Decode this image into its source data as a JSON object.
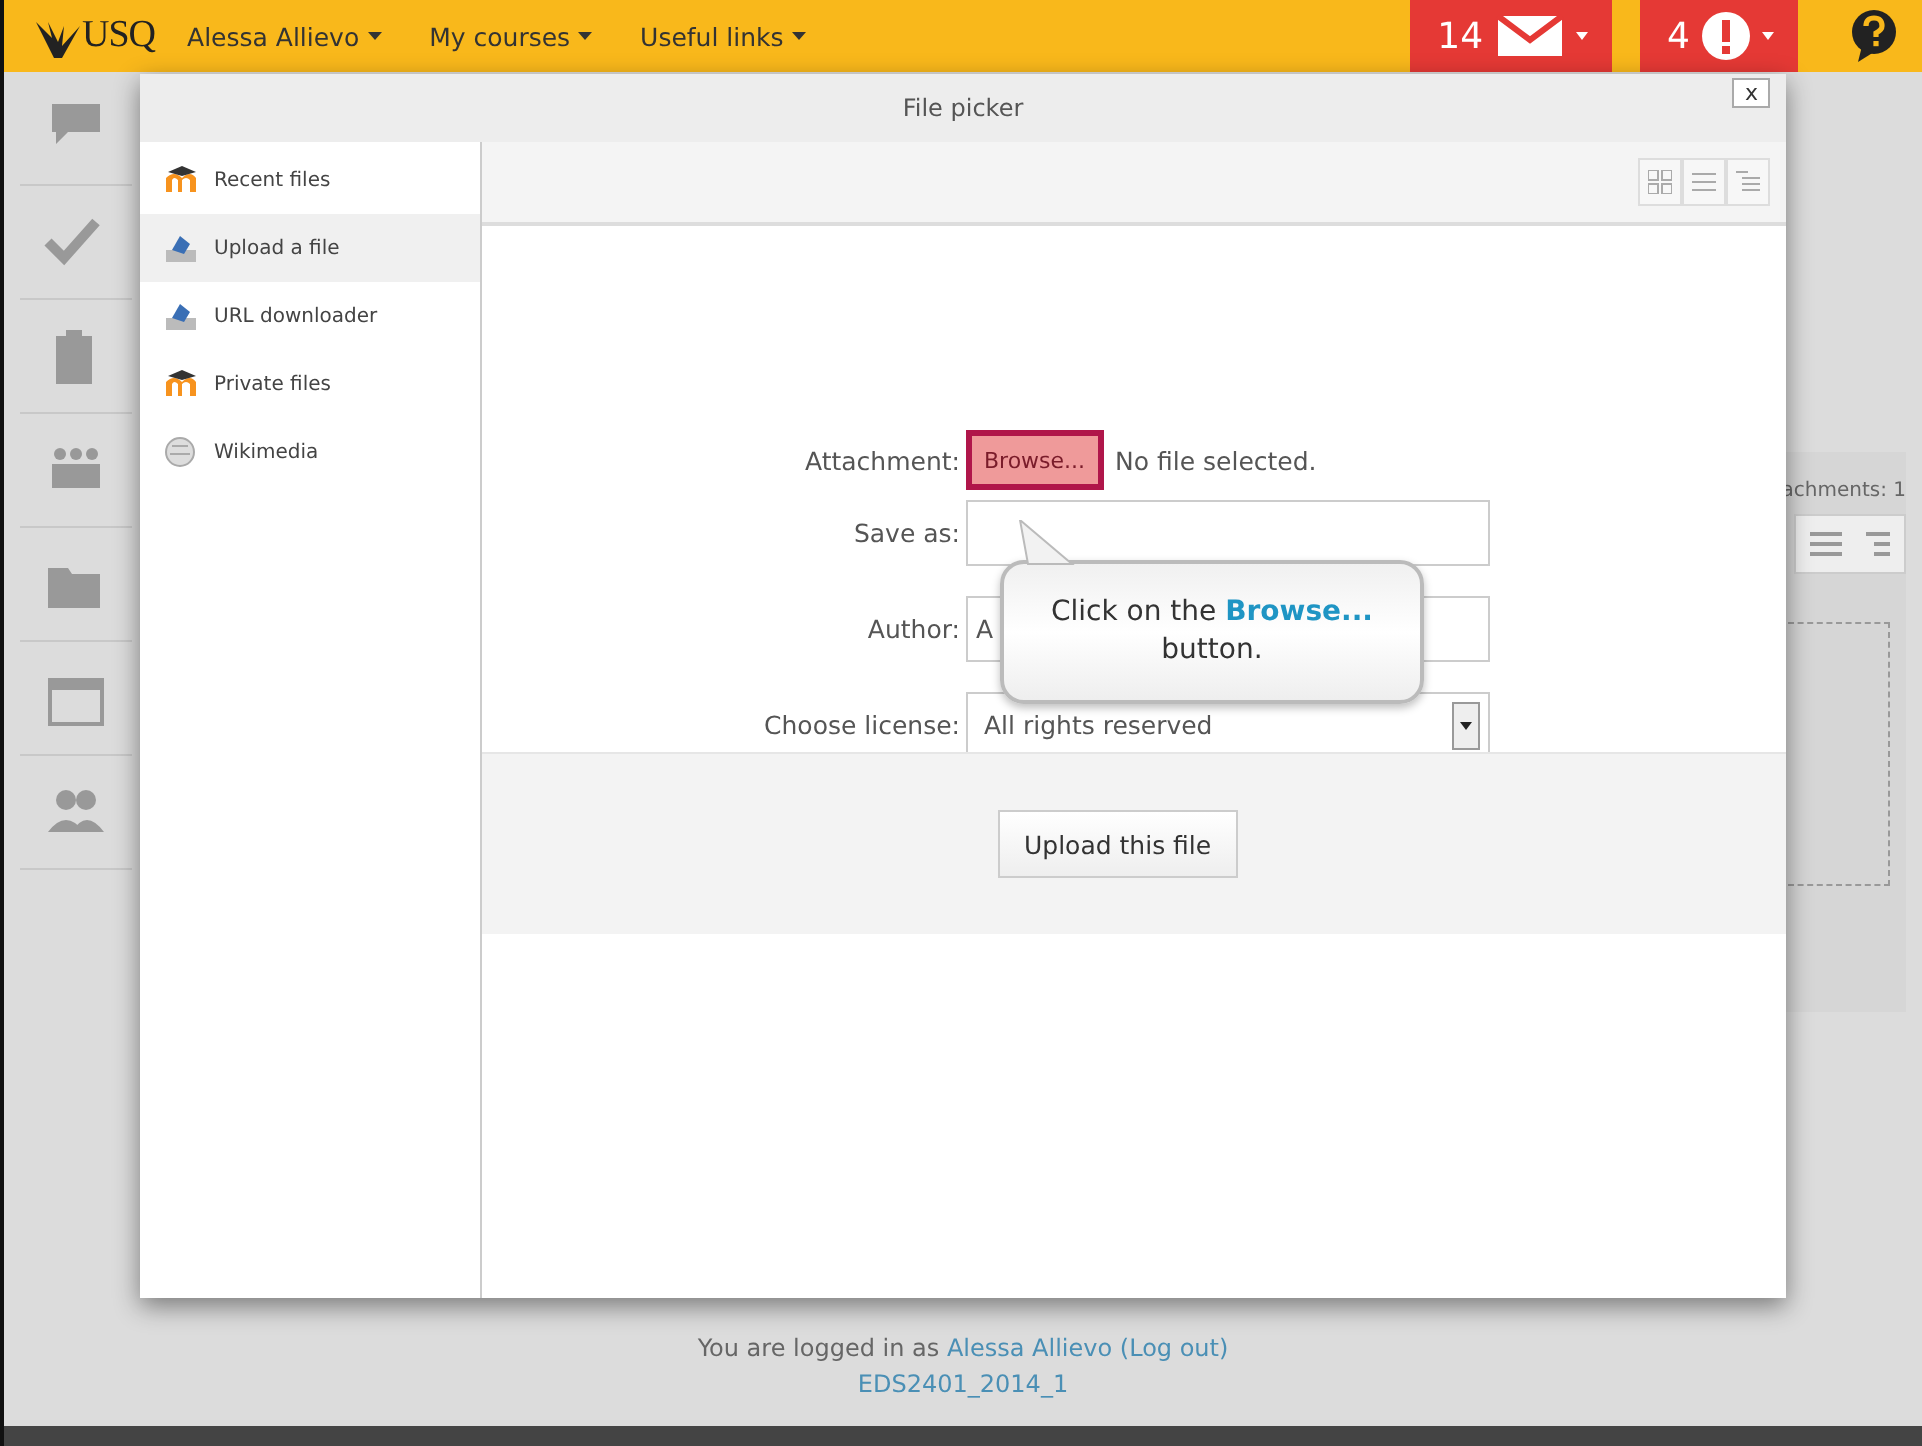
{
  "topbar": {
    "logo": "USQ",
    "menus": [
      {
        "label": "Alessa Allievo"
      },
      {
        "label": "My courses"
      },
      {
        "label": "Useful links"
      }
    ],
    "messages": {
      "count": "14"
    },
    "notifications": {
      "count": "4"
    }
  },
  "background": {
    "attachments_label": "achments: 1",
    "footer": {
      "text": "You are logged in as",
      "user": "Alessa Allievo",
      "logout": "(Log out)",
      "course": "EDS2401_2014_1"
    }
  },
  "dialog": {
    "title": "File picker",
    "close": "x",
    "repositories": [
      {
        "label": "Recent files",
        "kind": "moodle",
        "selected": false
      },
      {
        "label": "Upload a file",
        "kind": "upload",
        "selected": true
      },
      {
        "label": "URL downloader",
        "kind": "upload",
        "selected": false
      },
      {
        "label": "Private files",
        "kind": "moodle",
        "selected": false
      },
      {
        "label": "Wikimedia",
        "kind": "globe",
        "selected": false
      }
    ],
    "form": {
      "attachment_label": "Attachment:",
      "browse_button": "Browse...",
      "no_file": "No file selected.",
      "save_as_label": "Save as:",
      "author_label": "Author:",
      "author_value": "A",
      "license_label": "Choose license:",
      "license_value": "All rights reserved"
    },
    "upload_button": "Upload this file"
  },
  "callout": {
    "text": "Click on the **Browse...** button."
  }
}
